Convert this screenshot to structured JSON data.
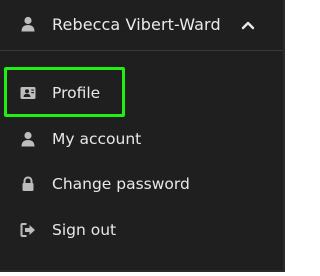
{
  "user_menu": {
    "user_name": "Rebecca Vibert-Ward",
    "user_icon": "user-icon",
    "toggle_icon": "chevron-up-icon",
    "expanded": true
  },
  "menu_items": [
    {
      "label": "Profile",
      "icon": "id-card-icon",
      "highlighted": true
    },
    {
      "label": "My account",
      "icon": "user-icon",
      "highlighted": false
    },
    {
      "label": "Change password",
      "icon": "lock-icon",
      "highlighted": false
    },
    {
      "label": "Sign out",
      "icon": "sign-out-icon",
      "highlighted": false
    }
  ],
  "colors": {
    "background": "#1f1f1f",
    "text": "#e8e8e8",
    "icon": "#bdbdbd",
    "highlight_border": "#22ee11"
  }
}
